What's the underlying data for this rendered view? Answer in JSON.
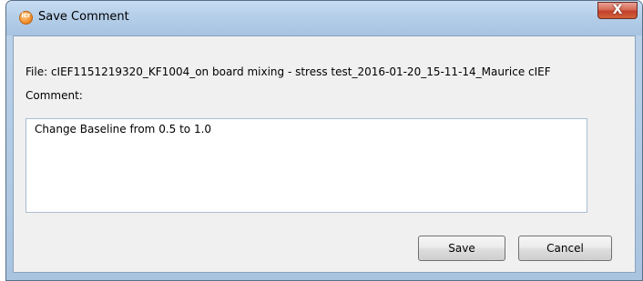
{
  "window": {
    "title": "Save Comment",
    "close_glyph": "X",
    "app_icon": "icr-app-icon",
    "app_icon_text": "icr"
  },
  "form": {
    "file_line": "File: cIEF1151219320_KF1004_on board mixing - stress test_2016-01-20_15-11-14_Maurice cIEF",
    "comment_label": "Comment:",
    "comment_value": "Change Baseline from 0.5 to 1.0"
  },
  "buttons": {
    "save_label": "Save",
    "cancel_label": "Cancel"
  },
  "colors": {
    "titlebar": "#b5cfe9",
    "close_button": "#c2402b",
    "dialog_background": "#f0f0f0"
  }
}
